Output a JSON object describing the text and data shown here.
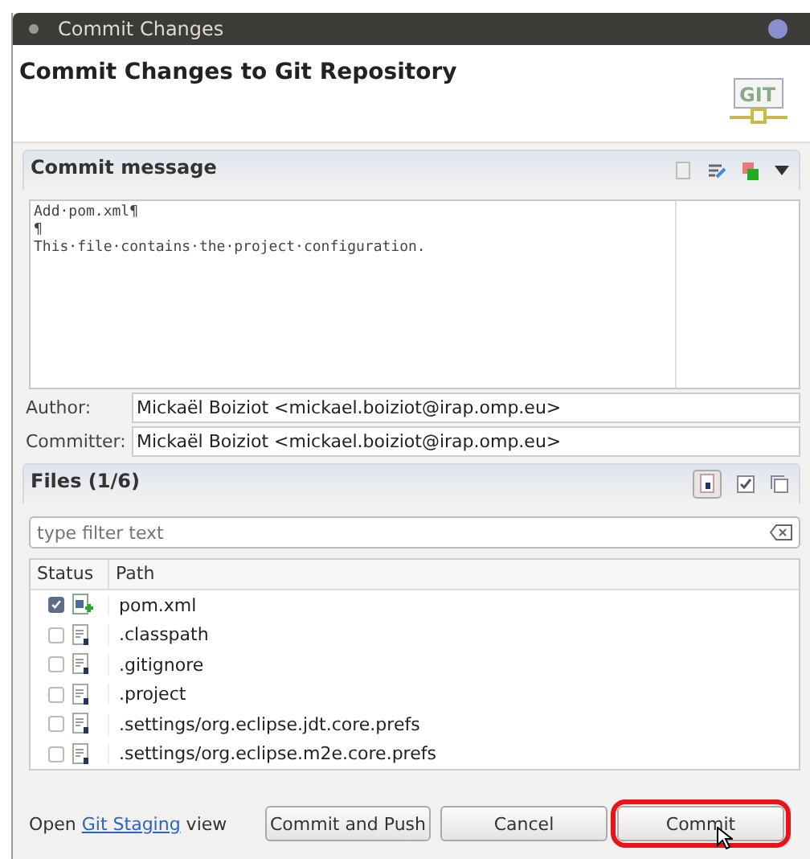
{
  "window": {
    "title": "Commit Changes"
  },
  "header": {
    "title": "Commit Changes to Git Repository",
    "logo": "GIT"
  },
  "commit_message": {
    "title": "Commit message",
    "lines": [
      "Add·pom.xml¶",
      "¶",
      "This·file·contains·the·project·configuration."
    ]
  },
  "author": {
    "label": "Author:",
    "value": "Mickaël Boiziot <mickael.boiziot@irap.omp.eu>"
  },
  "committer": {
    "label": "Committer:",
    "value": "Mickaël Boiziot <mickael.boiziot@irap.omp.eu>"
  },
  "files": {
    "title": "Files (1/6)",
    "filter": {
      "placeholder": "type filter text"
    },
    "columns": [
      "Status",
      "Path"
    ],
    "rows": [
      {
        "path": "pom.xml",
        "checked": true,
        "kind": "added"
      },
      {
        "path": ".classpath",
        "checked": false,
        "kind": "untracked"
      },
      {
        "path": ".gitignore",
        "checked": false,
        "kind": "untracked"
      },
      {
        "path": ".project",
        "checked": false,
        "kind": "untracked"
      },
      {
        "path": ".settings/org.eclipse.jdt.core.prefs",
        "checked": false,
        "kind": "untracked"
      },
      {
        "path": ".settings/org.eclipse.m2e.core.prefs",
        "checked": false,
        "kind": "untracked"
      }
    ]
  },
  "staging_note": {
    "before": "Open ",
    "link": "Git Staging",
    "after": " view"
  },
  "buttons": [
    {
      "label": "Commit and Push",
      "highlighted": false
    },
    {
      "label": "Cancel",
      "highlighted": false
    },
    {
      "label": "Commit",
      "highlighted": true
    }
  ]
}
